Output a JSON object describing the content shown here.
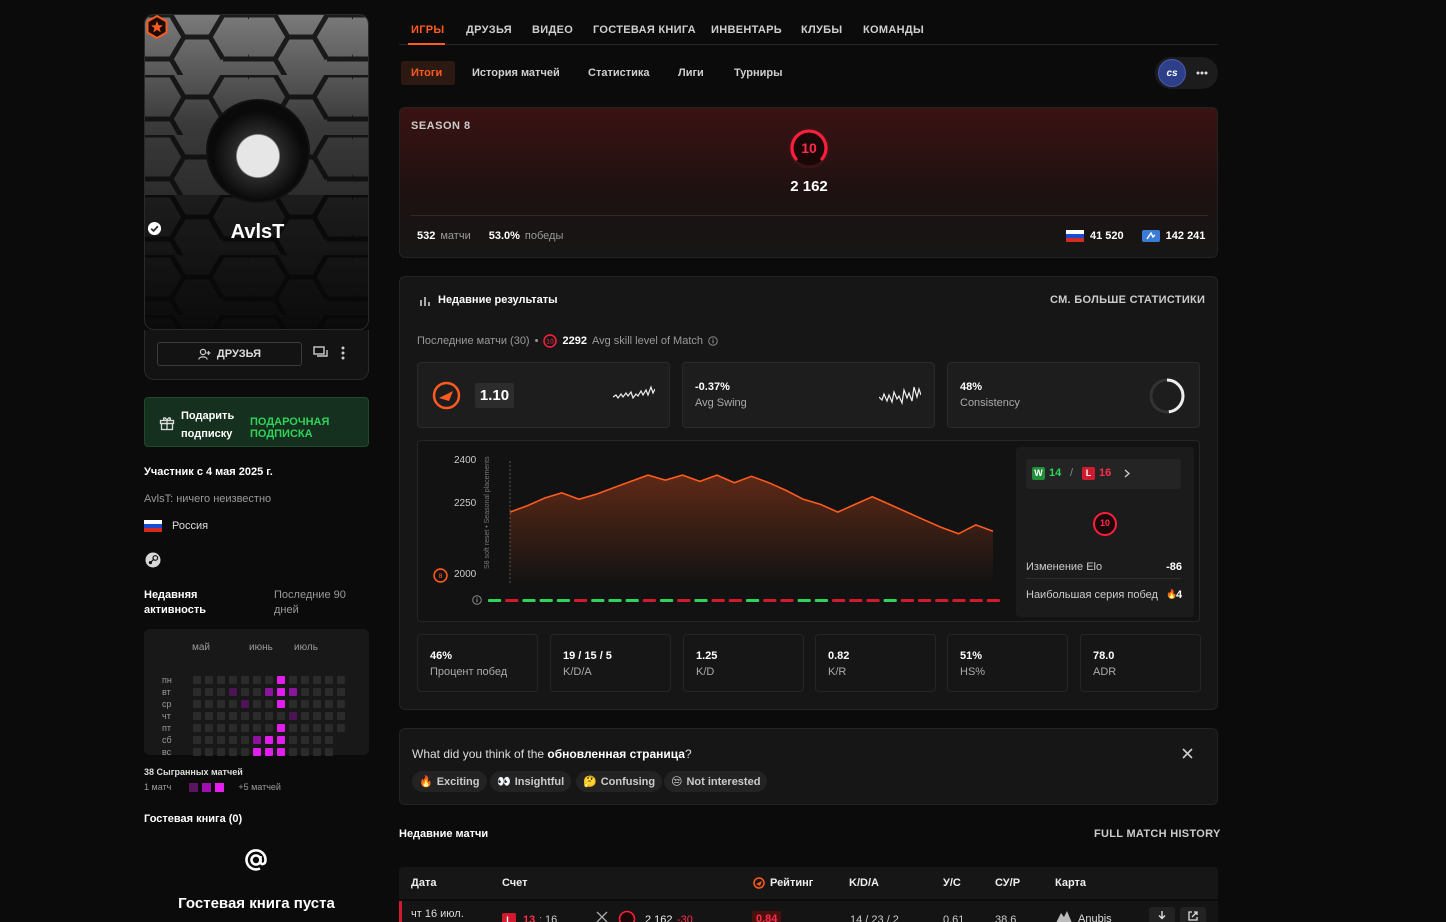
{
  "profile": {
    "name": "AvlsT",
    "friends_label": "ДРУЗЬЯ",
    "gift_line1": "Подарить",
    "gift_line2": "подписку",
    "gift_action": "ПОДАРОЧНАЯ ПОДПИСКА",
    "member_since": "Участник с 4 мая 2025 г.",
    "bio": "AvlsT: ничего неизвестно",
    "country": "Россия",
    "recent_activity_label_1": "Недавняя",
    "recent_activity_label_2": "активность",
    "recent_activity_period_1": "Последние 90",
    "recent_activity_period_2": "дней",
    "months": [
      "май",
      "июнь",
      "июль"
    ],
    "weekdays": [
      "пн",
      "вт",
      "ср",
      "чт",
      "пт",
      "сб",
      "вс"
    ],
    "matches_played": "38 Сыгранных матчей",
    "legend_min": "1 матч",
    "legend_max": "+5 матчей",
    "guestbook_title": "Гостевая книга (0)",
    "guestbook_empty": "Гостевая книга пуста"
  },
  "nav": {
    "tabs": [
      "ИГРЫ",
      "ДРУЗЬЯ",
      "ВИДЕО",
      "ГОСТЕВАЯ КНИГА",
      "ИНВЕНТАРЬ",
      "КЛУБЫ",
      "КОМАНДЫ"
    ],
    "active_tab": "ИГРЫ",
    "subtabs": [
      "Итоги",
      "История матчей",
      "Статистика",
      "Лиги",
      "Турниры"
    ],
    "game_badge": "cs"
  },
  "season": {
    "label": "SEASON 8",
    "level": "10",
    "elo": "2 162",
    "matches_value": "532",
    "matches_label": "матчи",
    "winrate_value": "53.0%",
    "winrate_label": "победы",
    "country_rank": "41 520",
    "region_rank": "142 241"
  },
  "recent": {
    "title": "Недавние результаты",
    "more_stats": "СМ. БОЛЬШЕ СТАТИСТИКИ",
    "last_matches": "Последние матчи (30)",
    "avg_skill_value": "2292",
    "avg_skill_label": "Avg skill level of Match",
    "rating_value": "1.10",
    "swing_value": "-0.37%",
    "swing_label": "Avg Swing",
    "consistency_value": "48%",
    "consistency_label": "Consistency",
    "consistency_fraction": 0.48
  },
  "chart_data": {
    "type": "line",
    "yticks": [
      "2400",
      "2250",
      "2000"
    ],
    "ylim": [
      2000,
      2450
    ],
    "annotation": "S8 soft reset • Seasonal placements",
    "values": [
      2250,
      2275,
      2305,
      2325,
      2300,
      2320,
      2345,
      2370,
      2395,
      2375,
      2395,
      2370,
      2395,
      2365,
      2390,
      2365,
      2335,
      2300,
      2280,
      2250,
      2280,
      2310,
      2280,
      2250,
      2220,
      2190,
      2165,
      2200,
      2175
    ],
    "results": [
      "W",
      "L",
      "W",
      "W",
      "W",
      "L",
      "W",
      "W",
      "W",
      "L",
      "W",
      "L",
      "W",
      "L",
      "L",
      "W",
      "L",
      "L",
      "W",
      "W",
      "L",
      "L",
      "L",
      "W",
      "L",
      "L",
      "L",
      "L",
      "L",
      "L"
    ]
  },
  "summary": {
    "wins_label": "W",
    "wins": "14",
    "losses_label": "L",
    "losses": "16",
    "level": "10",
    "elo_change_label": "Изменение Elo",
    "elo_change": "-86",
    "streak_label": "Наибольшая серия побед",
    "streak": "4"
  },
  "stats": [
    {
      "value": "46%",
      "label": "Процент побед"
    },
    {
      "value": "19 / 15 / 5",
      "label": "K/D/A"
    },
    {
      "value": "1.25",
      "label": "K/D"
    },
    {
      "value": "0.82",
      "label": "K/R"
    },
    {
      "value": "51%",
      "label": "HS%"
    },
    {
      "value": "78.0",
      "label": "ADR"
    }
  ],
  "feedback": {
    "question_plain": "What did you think of the",
    "question_bold": "обновленная страница",
    "question_end": "?",
    "options": [
      "Exciting",
      "Insightful",
      "Confusing",
      "Not interested"
    ]
  },
  "matches": {
    "title": "Недавние матчи",
    "full_history": "FULL MATCH HISTORY",
    "headers": [
      "Дата",
      "Счет",
      "Рейтинг",
      "K/D/A",
      "У/С",
      "СУ/Р",
      "Карта"
    ],
    "rows": [
      {
        "date": "чт 16 июл.",
        "result": "L",
        "score_a": "13",
        "score_b": "16",
        "elo": "2 162",
        "delta": "-30",
        "rating": "0.84",
        "kda": "14 / 23 / 2",
        "kd": "0.61",
        "kr": "38.6",
        "map": "Anubis"
      }
    ]
  }
}
